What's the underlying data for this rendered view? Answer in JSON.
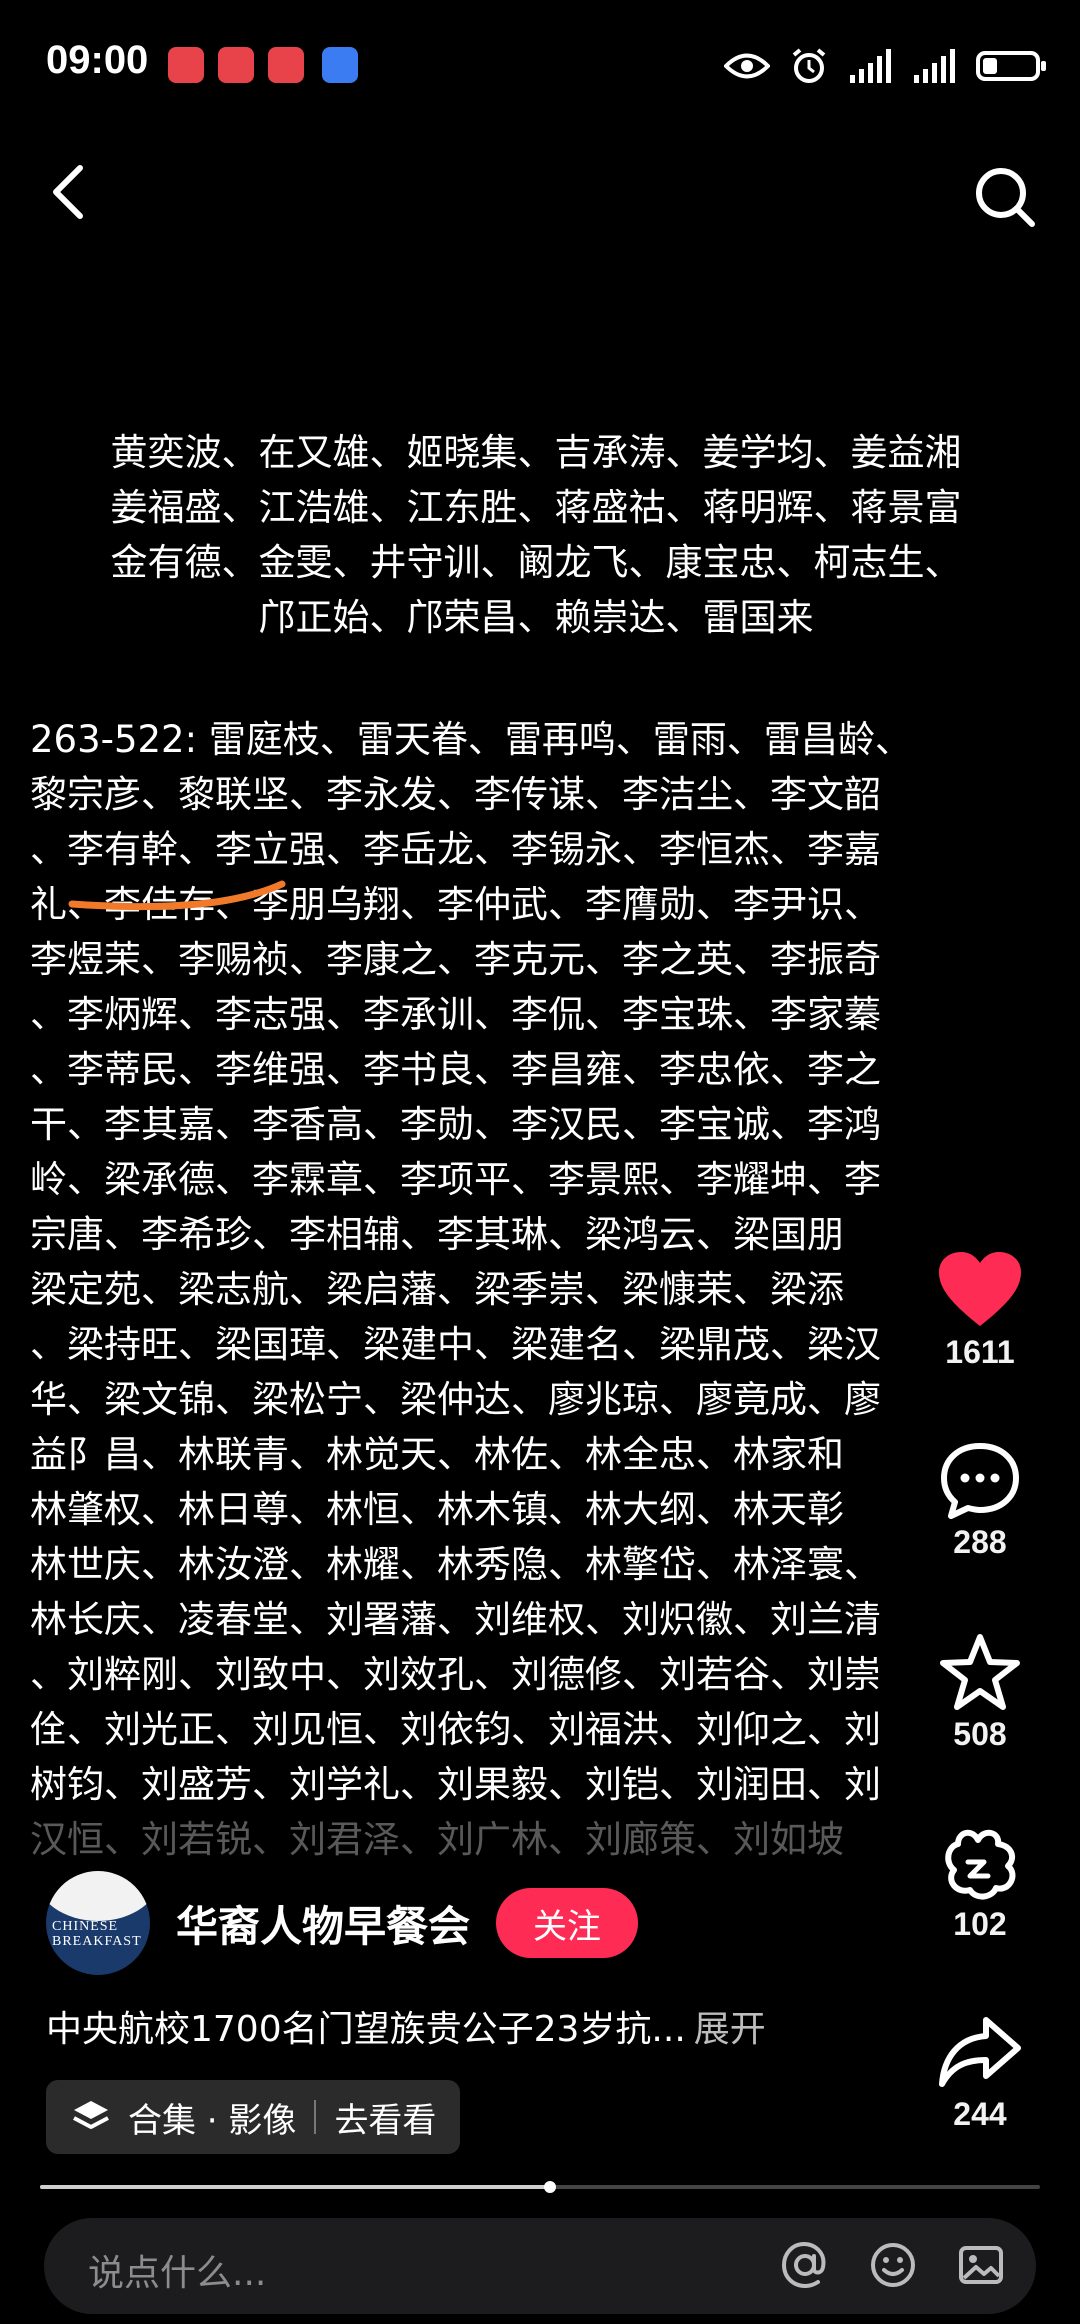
{
  "status_bar": {
    "time": "09:00",
    "notification_icons": [
      "app-notification-icon",
      "app-notification-icon",
      "app-notification-icon",
      "browser-notification-icon"
    ],
    "icons": [
      "eye-icon",
      "alarm-icon",
      "signal-icon",
      "signal-icon",
      "battery-icon"
    ]
  },
  "top_bar": {
    "back_icon": "chevron-left-icon",
    "search_icon": "search-icon"
  },
  "names_a": [
    "黄奕波、在又雄、姬晓集、吉承涛、姜学均、姜益湘",
    "姜福盛、江浩雄、江东胜、蒋盛祜、蒋明辉、蒋景富",
    "金有德、金雯、井守训、阚龙飞、康宝忠、柯志生、",
    "邝正始、邝荣昌、赖崇达、雷国来"
  ],
  "names_b": [
    "263-522:  雷庭枝、雷天眷、雷再鸣、雷雨、雷昌龄、",
    "黎宗彦、黎联坚、李永发、李传谋、李洁尘、李文韶",
    "、李有幹、李立强、李岳龙、李锡永、李恒杰、李嘉",
    "礼、李佳存、李朋乌翔、李仲武、李膺勋、李尹识、",
    "李煜茉、李赐祯、李康之、李克元、李之英、李振奇",
    "、李炳辉、李志强、李承训、李侃、李宝珠、李家蓁",
    "、李蒂民、李维强、李书良、李昌雍、李忠依、李之",
    "干、李其嘉、李香高、李勋、李汉民、李宝诚、李鸿",
    "岭、梁承德、李霖章、李项平、李景熙、李耀坤、李",
    "宗唐、李希珍、李相辅、李其琳、梁鸿云、梁国朋",
    "梁定苑、梁志航、梁启藩、梁季崇、梁慷茉、梁添",
    "、梁持旺、梁国璋、梁建中、梁建名、梁鼎茂、梁汉",
    "华、梁文锦、梁松宁、梁仲达、廖兆琼、廖竟成、廖",
    "益阝昌、林联青、林觉天、林佐、林全忠、林家和",
    "林肇权、林日尊、林恒、林木镇、林大纲、林天彰",
    "林世庆、林汝澄、林耀、林秀隐、林擎岱、林泽寰、",
    "林长庆、凌春堂、刘署藩、刘维权、刘炽徽、刘兰清",
    "、刘粹刚、刘致中、刘效孔、刘德修、刘若谷、刘崇",
    "佺、刘光正、刘见恒、刘依钧、刘福洪、刘仰之、刘",
    "树钧、刘盛芳、刘学礼、刘果毅、刘铠、刘润田、刘",
    "汉恒、刘若锐、刘君泽、刘广林、刘廊策、刘如坡"
  ],
  "side_actions": {
    "like": {
      "icon": "heart-icon",
      "count": "1611",
      "color": "#fe2c55"
    },
    "comment": {
      "icon": "comment-icon",
      "count": "288"
    },
    "favorite": {
      "icon": "star-icon",
      "count": "508"
    },
    "gift": {
      "icon": "gift-icon",
      "count": "102"
    },
    "share": {
      "icon": "share-icon",
      "count": "244"
    }
  },
  "author": {
    "avatar_text": "CHINESE BREAKFAST",
    "name": "华裔人物早餐会",
    "follow_label": "关注"
  },
  "caption": {
    "text": "中央航校1700名门望族贵公子23岁抗...",
    "expand": "展开"
  },
  "collection": {
    "label": "合集 · 影像",
    "action": "去看看"
  },
  "progress": {
    "fraction": 0.51
  },
  "comment_bar": {
    "placeholder": "说点什么...",
    "icons": [
      "at-icon",
      "emoji-icon",
      "image-icon"
    ]
  },
  "colors": {
    "accent": "#fe2c55",
    "background": "#000000"
  }
}
